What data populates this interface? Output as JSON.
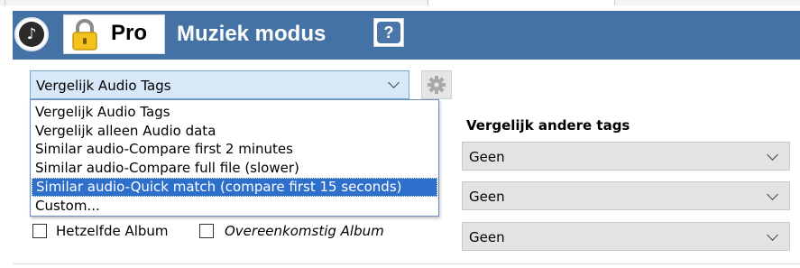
{
  "header": {
    "pro_label": "Pro",
    "title": "Muziek modus",
    "help_label": "?",
    "app_icon_glyph": "♪",
    "color": "#4472a4"
  },
  "compare_mode": {
    "selected": "Vergelijk Audio Tags",
    "options": [
      "Vergelijk Audio Tags",
      "Vergelijk alleen Audio data",
      "Similar audio-Compare first 2 minutes",
      "Similar audio-Compare full file (slower)",
      "Similar audio-Quick match (compare first 15 seconds)",
      "Custom..."
    ],
    "highlighted_index": 4
  },
  "checkboxes": {
    "same_album": "Hetzelfde Album",
    "similar_album": "Overeenkomstig Album"
  },
  "other_tags": {
    "heading": "Vergelijk andere tags",
    "selects": [
      "Geen",
      "Geen",
      "Geen"
    ]
  },
  "icons": {
    "app": "music-note-icon",
    "lock": "lock-icon",
    "help": "help-icon",
    "settings": "gear-icon",
    "dropdown": "chevron-down-icon"
  },
  "colors": {
    "accent": "#4472a4",
    "selection": "#2d6fca",
    "combo_bg": "#d7e8f8"
  }
}
